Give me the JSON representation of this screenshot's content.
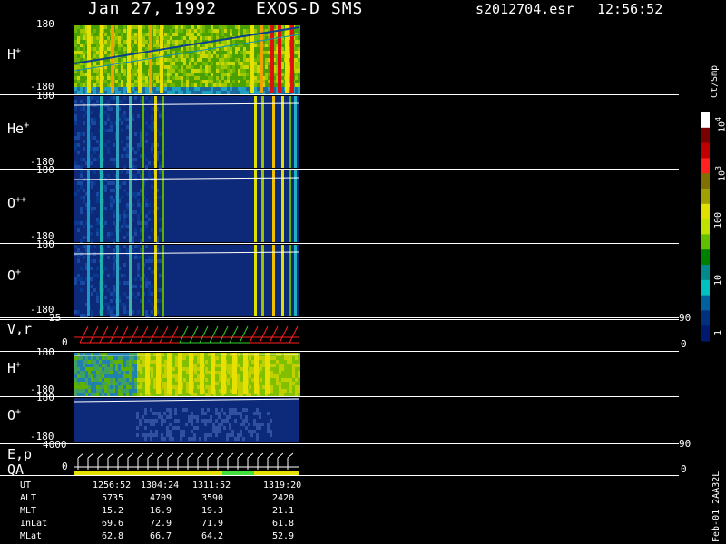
{
  "header": {
    "date": "Jan 27, 1992",
    "instrument": "EXOS-D SMS",
    "file": "s2012704.esr",
    "time": "12:56:52"
  },
  "colorbar": {
    "unit": "Ct/Smp",
    "ticks": [
      "10^4",
      "10^3",
      "100",
      "10",
      "1"
    ],
    "colors": [
      "#ffffff",
      "#7a0000",
      "#c00000",
      "#ff2020",
      "#807000",
      "#a0a000",
      "#e0e000",
      "#c0e000",
      "#60c000",
      "#008000",
      "#008a8a",
      "#00c0c0",
      "#0060a0",
      "#003080",
      "#001a70"
    ]
  },
  "panels": [
    {
      "name": "h-plus-top",
      "species": "H",
      "charge": "+",
      "ymax": "180",
      "ymin": "-180"
    },
    {
      "name": "he-plus",
      "species": "He",
      "charge": "+",
      "ymax": "180",
      "ymin": "-180"
    },
    {
      "name": "o-plusplus",
      "species": "O",
      "charge": "++",
      "ymax": "180",
      "ymin": "-180"
    },
    {
      "name": "o-plus-top",
      "species": "O",
      "charge": "+",
      "ymax": "180",
      "ymin": "-180"
    }
  ],
  "vr_panel": {
    "label": "V,r",
    "ymax": "25",
    "ymin": "0",
    "right_max": "90",
    "right_min": "0"
  },
  "h_plus_low": {
    "species": "H",
    "charge": "+",
    "ymax": "180",
    "ymin": "-180"
  },
  "o_plus_low": {
    "species": "O",
    "charge": "+",
    "ymax": "180",
    "ymin": "-180"
  },
  "ep_panel": {
    "label": "E,p",
    "label2": "QA",
    "ymax": "4000",
    "ymin": "0",
    "right_max": "90",
    "right_min": "0"
  },
  "orbit_table": {
    "rows": [
      {
        "name": "UT",
        "values": [
          "1256:52",
          "1304:24",
          "1311:52",
          "1319:20"
        ]
      },
      {
        "name": "ALT",
        "values": [
          "5735",
          "4709",
          "3590",
          "2420"
        ]
      },
      {
        "name": "MLT",
        "values": [
          "15.2",
          "16.9",
          "19.3",
          "21.1"
        ]
      },
      {
        "name": "InLat",
        "values": [
          "69.6",
          "72.9",
          "71.9",
          "61.8"
        ]
      },
      {
        "name": "MLat",
        "values": [
          "62.8",
          "66.7",
          "64.2",
          "52.9"
        ]
      }
    ]
  },
  "footer_vertical": "Feb-01 2AA32L",
  "chart_data": {
    "type": "heatmap",
    "title": "Jan 27, 1992 EXOS-D SMS",
    "x_ticks": [
      "1256:52",
      "1304:24",
      "1311:52",
      "1319:20"
    ],
    "panels": [
      "H+",
      "He+",
      "O++",
      "O+",
      "V,r",
      "H+",
      "O+",
      "E,p / QA"
    ],
    "pitch_angle_range": [
      -180,
      180
    ],
    "colorbar_scale": "log",
    "colorbar_range": [
      1,
      10000
    ]
  }
}
